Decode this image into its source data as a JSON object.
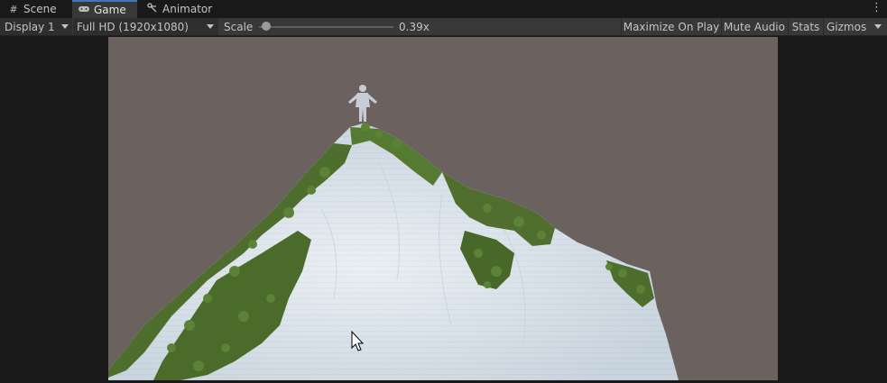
{
  "tabs": [
    {
      "label": "Scene",
      "icon": "grid-icon",
      "active": false
    },
    {
      "label": "Game",
      "icon": "gamepad-icon",
      "active": true
    },
    {
      "label": "Animator",
      "icon": "animator-icon",
      "active": false
    }
  ],
  "toolbar": {
    "display": "Display 1",
    "resolution": "Full HD (1920x1080)",
    "scale_label": "Scale",
    "scale_value": "0.39x",
    "maximize": "Maximize On Play",
    "mute": "Mute Audio",
    "stats": "Stats",
    "gizmos": "Gizmos"
  },
  "colors": {
    "accent": "#3a79bb",
    "viewport_bg": "#6b6260",
    "mountain": "#dde6ee",
    "foliage": "#4d6e2c"
  },
  "scene": {
    "objects": [
      "humanoid-character",
      "snow-mountain",
      "trees",
      "mouse-cursor"
    ]
  }
}
